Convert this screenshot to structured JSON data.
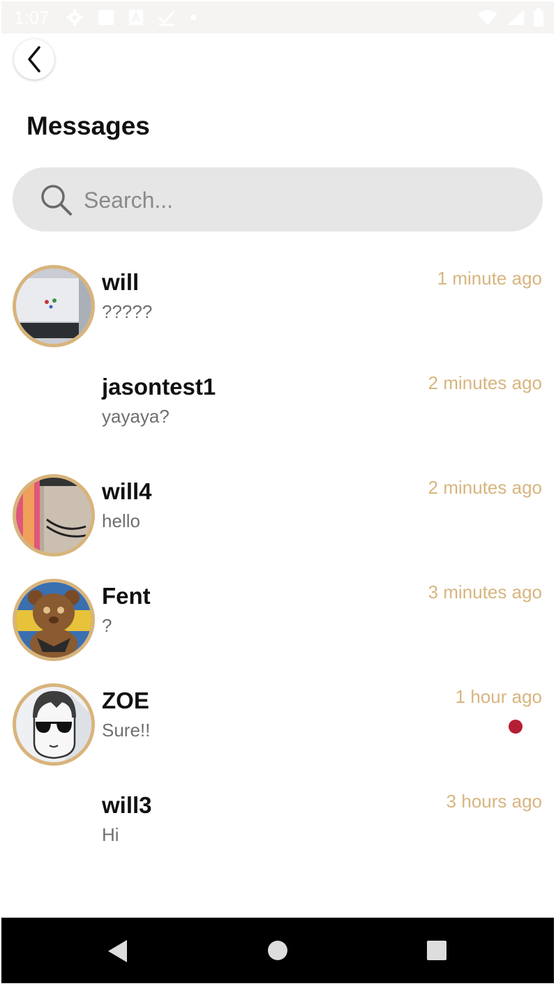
{
  "status_bar": {
    "time": "1:07",
    "left_icons": [
      "settings-icon",
      "square-icon",
      "a-box-icon",
      "check-icon",
      "dot-icon"
    ],
    "right_icons": [
      "wifi-icon",
      "signal-icon",
      "battery-icon"
    ]
  },
  "header": {
    "back_icon": "chevron-left-icon",
    "title": "Messages"
  },
  "search": {
    "placeholder": "Search...",
    "value": ""
  },
  "conversations": [
    {
      "name": "will",
      "preview": "?????",
      "time": "1 minute ago",
      "has_avatar": true,
      "avatar": "monitor-photo",
      "unread": false
    },
    {
      "name": "jasontest1",
      "preview": "yayaya?",
      "time": "2 minutes ago",
      "has_avatar": false,
      "unread": false
    },
    {
      "name": "will4",
      "preview": "hello",
      "time": "2 minutes ago",
      "has_avatar": true,
      "avatar": "desk-photo",
      "unread": false
    },
    {
      "name": "Fent",
      "preview": "?",
      "time": "3 minutes ago",
      "has_avatar": true,
      "avatar": "teddy-bear-photo",
      "unread": false
    },
    {
      "name": "ZOE",
      "preview": "Sure!!",
      "time": "1 hour ago",
      "has_avatar": true,
      "avatar": "sunglasses-cartoon",
      "unread": true
    },
    {
      "name": "will3",
      "preview": "Hi",
      "time": "3 hours ago",
      "has_avatar": false,
      "unread": false
    }
  ],
  "colors": {
    "accent_gold": "#d7b57f",
    "avatar_ring": "#d8b47c",
    "unread_dot": "#b51f35",
    "search_bg": "#e6e6e6"
  },
  "nav_bar": {
    "icons": [
      "nav-back-icon",
      "nav-home-icon",
      "nav-recents-icon"
    ]
  }
}
